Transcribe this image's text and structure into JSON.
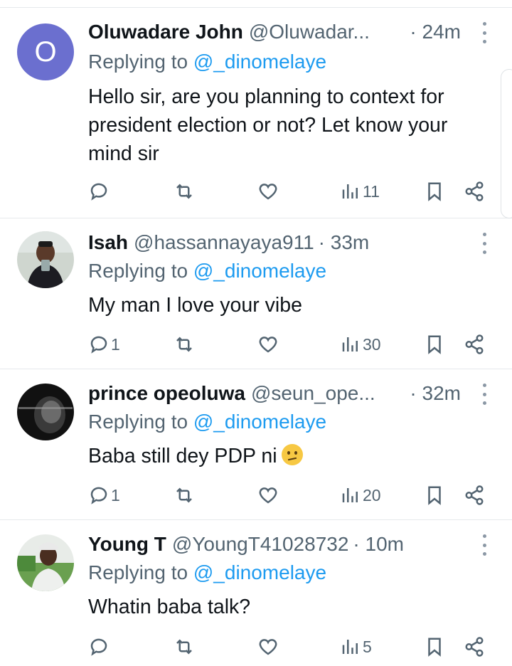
{
  "replies": [
    {
      "name": "Oluwadare John",
      "handle": "@Oluwadar...",
      "time": "· 24m",
      "avatar_letter": "O",
      "replying_prefix": "Replying to",
      "replying_to": "@_dinomelaye",
      "text_lines": [
        "Hello sir, are you planning to context for",
        "president election or not? Let know your",
        "mind sir"
      ],
      "stats": {
        "replies": "",
        "reposts": "",
        "likes": "",
        "views": "11"
      }
    },
    {
      "name": "Isah",
      "handle": "@hassannayaya911",
      "time": "· 33m",
      "avatar_letter": "",
      "replying_prefix": "Replying to",
      "replying_to": "@_dinomelaye",
      "text_lines": [
        "My man I love your vibe"
      ],
      "stats": {
        "replies": "1",
        "reposts": "",
        "likes": "",
        "views": "30"
      }
    },
    {
      "name": "prince opeoluwa",
      "handle": "@seun_ope...",
      "time": "· 32m",
      "avatar_letter": "",
      "replying_prefix": "Replying to",
      "replying_to": "@_dinomelaye",
      "text_lines": [
        "Baba still dey PDP ni"
      ],
      "emoji": "confused-face-emoji",
      "stats": {
        "replies": "1",
        "reposts": "",
        "likes": "",
        "views": "20"
      }
    },
    {
      "name": "Young T",
      "handle": "@YoungT41028732",
      "time": "· 10m",
      "avatar_letter": "",
      "replying_prefix": "Replying to",
      "replying_to": "@_dinomelaye",
      "text_lines": [
        "Whatin baba talk?"
      ],
      "stats": {
        "replies": "",
        "reposts": "",
        "likes": "",
        "views": "5"
      }
    }
  ],
  "colors": {
    "accent": "#1d9bf0",
    "secondary_text": "#536471",
    "avatar_letter_bg": "#6b6fcf",
    "divider": "#e6e9ec"
  },
  "icons": [
    "reply-icon",
    "repost-icon",
    "like-icon",
    "views-icon",
    "bookmark-icon",
    "share-icon",
    "more-icon"
  ]
}
